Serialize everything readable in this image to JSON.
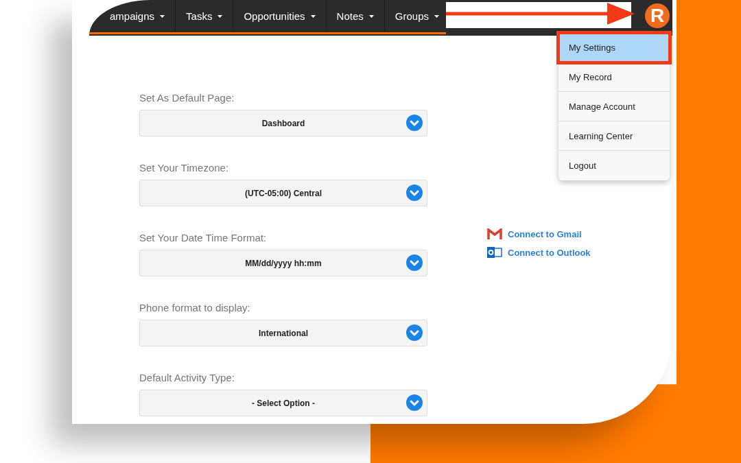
{
  "nav": {
    "items": [
      {
        "label": "ampaigns"
      },
      {
        "label": "Tasks"
      },
      {
        "label": "Opportunities"
      },
      {
        "label": "Notes"
      },
      {
        "label": "Groups"
      }
    ],
    "avatar": "R"
  },
  "menu": {
    "items": [
      {
        "label": "My Settings",
        "selected": true
      },
      {
        "label": "My Record",
        "selected": false
      },
      {
        "label": "Manage Account",
        "selected": false
      },
      {
        "label": "Learning Center",
        "selected": false
      },
      {
        "label": "Logout",
        "selected": false
      }
    ]
  },
  "fields": [
    {
      "label": "Set As Default Page:",
      "value": "Dashboard"
    },
    {
      "label": "Set Your Timezone:",
      "value": "(UTC-05:00) Central"
    },
    {
      "label": "Set Your Date Time Format:",
      "value": "MM/dd/yyyy hh:mm"
    },
    {
      "label": "Phone format to display:",
      "value": "International"
    },
    {
      "label": "Default Activity Type:",
      "value": "- Select Option -"
    }
  ],
  "connections": [
    {
      "kind": "gmail",
      "label": "Connect to Gmail"
    },
    {
      "kind": "outlook",
      "label": "Connect to Outlook"
    }
  ]
}
